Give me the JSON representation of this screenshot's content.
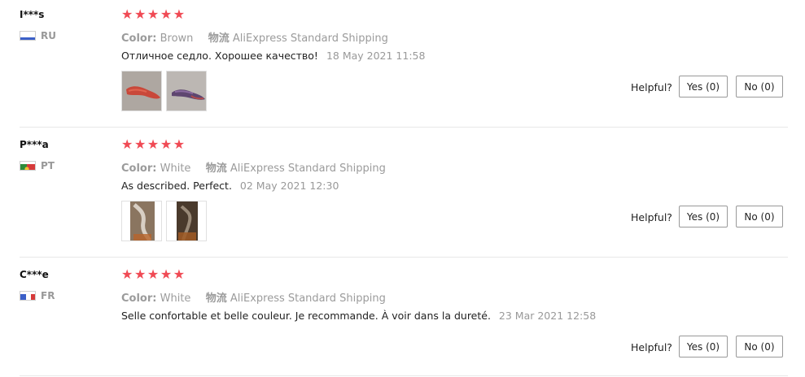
{
  "labels": {
    "color_label": "Color:",
    "shipping_label": "物流",
    "helpful": "Helpful?"
  },
  "colors": {
    "star": "#f04a54",
    "muted": "#9b9b9b"
  },
  "reviews": [
    {
      "user": "I***s",
      "country": "RU",
      "flag_icon": "flag-ru-icon",
      "stars": "★★★★★",
      "rating": 5,
      "color": "Brown",
      "shipping": "AliExpress Standard Shipping",
      "text": "Отличное седло. Хорошее качество!",
      "date": "18 May 2021 11:58",
      "yes": "Yes (0)",
      "no": "No (0)"
    },
    {
      "user": "P***a",
      "country": "PT",
      "flag_icon": "flag-pt-icon",
      "stars": "★★★★★",
      "rating": 5,
      "color": "White",
      "shipping": "AliExpress Standard Shipping",
      "text": "As described. Perfect.",
      "date": "02 May 2021 12:30",
      "yes": "Yes (0)",
      "no": "No (0)"
    },
    {
      "user": "C***e",
      "country": "FR",
      "flag_icon": "flag-fr-icon",
      "stars": "★★★★★",
      "rating": 5,
      "color": "White",
      "shipping": "AliExpress Standard Shipping",
      "text": "Selle confortable et belle couleur. Je recommande. À voir dans la dureté.",
      "date": "23 Mar 2021 12:58",
      "yes": "Yes (0)",
      "no": "No (0)"
    }
  ]
}
